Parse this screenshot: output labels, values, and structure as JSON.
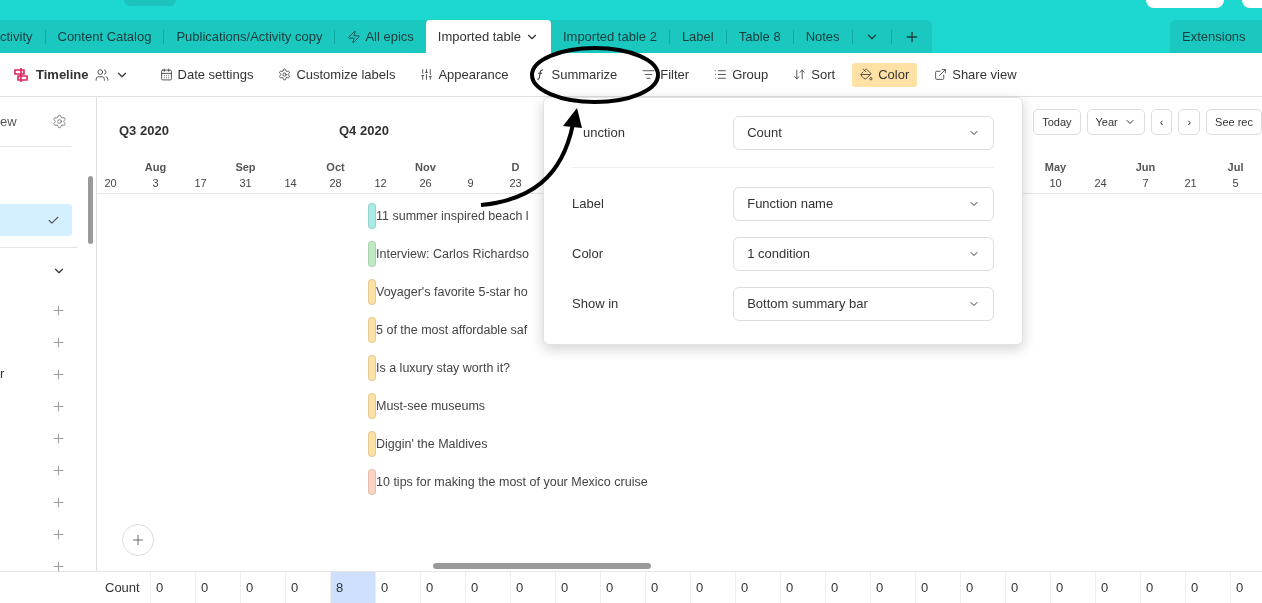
{
  "tabs": [
    {
      "label": "ctivity",
      "selected": false,
      "kind": "plain"
    },
    {
      "label": "Content Catalog",
      "selected": false,
      "kind": "plain"
    },
    {
      "label": "Publications/Activity copy",
      "selected": false,
      "kind": "plain"
    },
    {
      "label": "All epics",
      "selected": false,
      "kind": "bolt"
    },
    {
      "label": "Imported table",
      "selected": true,
      "kind": "plain"
    },
    {
      "label": "Imported table 2",
      "selected": false,
      "kind": "plain"
    },
    {
      "label": "Label",
      "selected": false,
      "kind": "plain"
    },
    {
      "label": "Table 8",
      "selected": false,
      "kind": "plain"
    },
    {
      "label": "Notes",
      "selected": false,
      "kind": "plain"
    }
  ],
  "extensions": "Extensions",
  "view": {
    "name": "Timeline"
  },
  "toolbar": [
    {
      "label": "Date settings",
      "active": false
    },
    {
      "label": "Customize labels",
      "active": false
    },
    {
      "label": "Appearance",
      "active": false
    },
    {
      "label": "Summarize",
      "active": false
    },
    {
      "label": "Filter",
      "active": false
    },
    {
      "label": "Group",
      "active": false
    },
    {
      "label": "Sort",
      "active": false
    },
    {
      "label": "Color",
      "active": true
    },
    {
      "label": "Share view",
      "active": false
    }
  ],
  "sidebar": {
    "title": "ew",
    "items": [
      {
        "selected": true
      }
    ],
    "add_rows": [
      {
        "kind": "plain"
      },
      {
        "kind": "plain"
      },
      {
        "kind": "labeled",
        "label": "r"
      },
      {
        "kind": "plain"
      },
      {
        "kind": "plain"
      },
      {
        "kind": "plain"
      },
      {
        "kind": "plain"
      },
      {
        "kind": "plain"
      },
      {
        "kind": "plain"
      }
    ]
  },
  "timeline": {
    "quarters": [
      "Q3 2020",
      "Q4 2020"
    ],
    "controls": [
      {
        "label": "Today",
        "kind": "button"
      },
      {
        "label": "Year",
        "kind": "dropdown"
      },
      {
        "label": "‹",
        "kind": "button"
      },
      {
        "label": "›",
        "kind": "button"
      },
      {
        "label": "See rec",
        "kind": "button"
      }
    ],
    "columns_left": [
      {
        "day": "20"
      },
      {
        "day": "3",
        "month": "Aug"
      },
      {
        "day": "17"
      },
      {
        "day": "31",
        "month": "Sep"
      },
      {
        "day": "14"
      },
      {
        "day": "28",
        "month": "Oct"
      },
      {
        "day": "12"
      },
      {
        "day": "26",
        "month": "Nov"
      },
      {
        "day": "9"
      },
      {
        "day": "23",
        "month": "D"
      }
    ],
    "columns_right": [
      {
        "day": "10",
        "month": "May"
      },
      {
        "day": "24"
      },
      {
        "day": "7",
        "month": "Jun"
      },
      {
        "day": "21"
      },
      {
        "day": "5",
        "month": "Jul"
      }
    ],
    "items": [
      {
        "title": "11 summer inspired beach l",
        "color": "#a8ebe6"
      },
      {
        "title": "Interview: Carlos Richardso",
        "color": "#bfeac3"
      },
      {
        "title": "Voyager's favorite 5-star ho",
        "color": "#fde2a6"
      },
      {
        "title": "5 of the most affordable saf",
        "color": "#fde2a6"
      },
      {
        "title": "Is a luxury stay worth it?",
        "color": "#fde2a6"
      },
      {
        "title": "Must-see museums",
        "color": "#fde2a6"
      },
      {
        "title": "Diggin' the Maldives",
        "color": "#fde2a6"
      },
      {
        "title": "10 tips for making the most of your Mexico cruise",
        "color": "#fcd3c1"
      }
    ]
  },
  "summary": {
    "label": "Count",
    "cells": [
      {
        "value": "0",
        "highlighted": false
      },
      {
        "value": "0",
        "highlighted": false
      },
      {
        "value": "0",
        "highlighted": false
      },
      {
        "value": "0",
        "highlighted": false
      },
      {
        "value": "8",
        "highlighted": true
      },
      {
        "value": "0",
        "highlighted": false
      },
      {
        "value": "0",
        "highlighted": false
      },
      {
        "value": "0",
        "highlighted": false
      },
      {
        "value": "0",
        "highlighted": false
      },
      {
        "value": "0",
        "highlighted": false
      },
      {
        "value": "0",
        "highlighted": false
      },
      {
        "value": "0",
        "highlighted": false
      },
      {
        "value": "0",
        "highlighted": false
      },
      {
        "value": "0",
        "highlighted": false
      },
      {
        "value": "0",
        "highlighted": false
      },
      {
        "value": "0",
        "highlighted": false
      },
      {
        "value": "0",
        "highlighted": false
      },
      {
        "value": "0",
        "highlighted": false
      },
      {
        "value": "0",
        "highlighted": false
      },
      {
        "value": "0",
        "highlighted": false
      },
      {
        "value": "0",
        "highlighted": false
      },
      {
        "value": "0",
        "highlighted": false
      },
      {
        "value": "0",
        "highlighted": false
      },
      {
        "value": "0",
        "highlighted": false
      },
      {
        "value": "0",
        "highlighted": false
      }
    ]
  },
  "popup": {
    "sections": [
      [
        {
          "label": "unction",
          "value": "Count"
        }
      ],
      [
        {
          "label": "Label",
          "value": "Function name"
        },
        {
          "label": "Color",
          "value": "1 condition"
        },
        {
          "label": "Show in",
          "value": "Bottom summary bar"
        }
      ]
    ]
  }
}
